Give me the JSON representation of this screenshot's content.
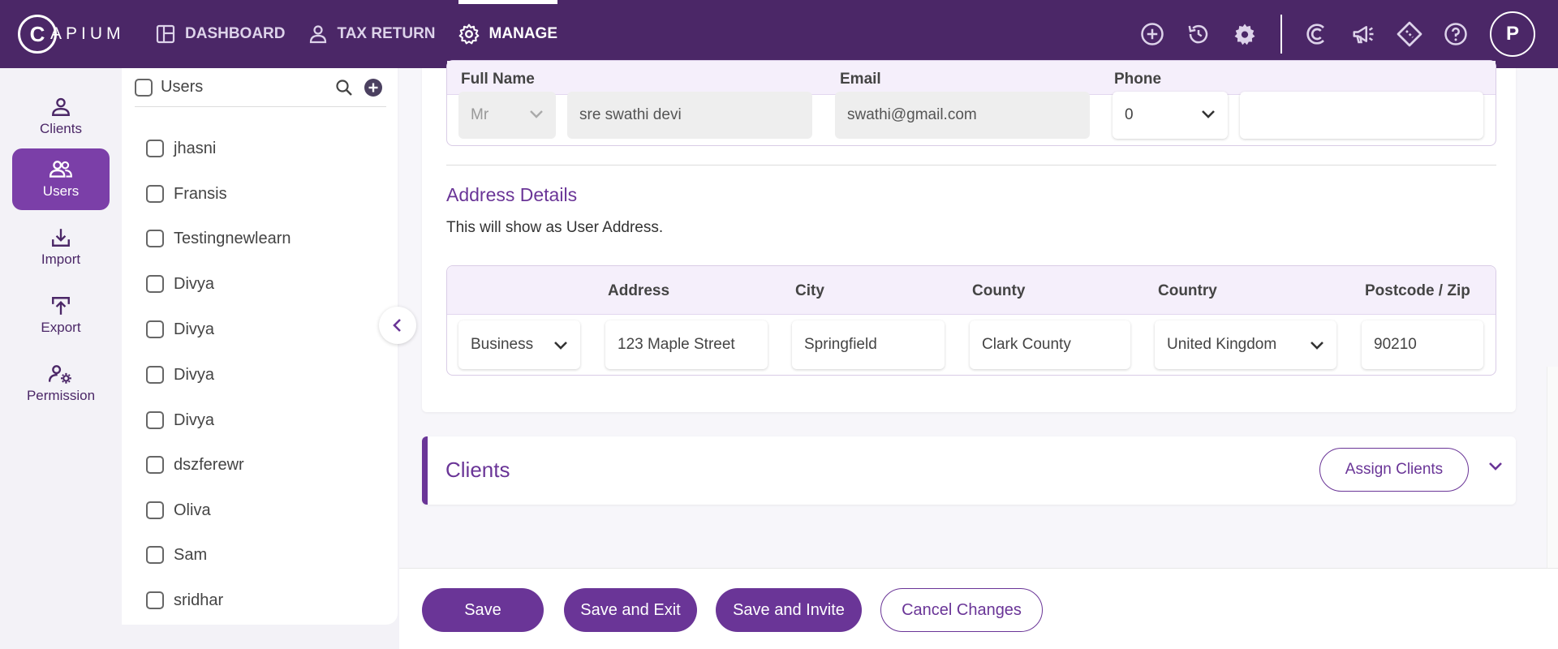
{
  "brand": {
    "logo_letter": "C",
    "logo_text": "APIUM"
  },
  "nav": [
    {
      "label": "DASHBOARD",
      "active": false
    },
    {
      "label": "TAX RETURN",
      "active": false
    },
    {
      "label": "MANAGE",
      "active": true
    }
  ],
  "top_icons": [
    "add-circle-icon",
    "history-icon",
    "settings-icon",
    "capium-icon",
    "megaphone-icon",
    "ticket-icon",
    "help-icon"
  ],
  "user_initial": "P",
  "rail": [
    {
      "label": "Clients",
      "icon": "person-icon",
      "active": false
    },
    {
      "label": "Users",
      "icon": "users-icon",
      "active": true
    },
    {
      "label": "Import",
      "icon": "import-icon",
      "active": false
    },
    {
      "label": "Export",
      "icon": "export-icon",
      "active": false
    },
    {
      "label": "Permission",
      "icon": "permission-icon",
      "active": false
    }
  ],
  "user_panel": {
    "title": "Users",
    "users": [
      "jhasni",
      "Fransis",
      "Testingnewlearn",
      "Divya",
      "Divya",
      "Divya",
      "Divya",
      "dszferewr",
      "Oliva",
      "Sam",
      "sridhar"
    ]
  },
  "contact": {
    "headers": {
      "full_name": "Full Name",
      "email": "Email",
      "phone": "Phone"
    },
    "title_value": "Mr",
    "name_value": "sre swathi devi",
    "email_value": "swathi@gmail.com",
    "phone_code": "0",
    "phone_value": ""
  },
  "address": {
    "section_title": "Address Details",
    "section_sub": "This will show as User Address.",
    "headers": {
      "address": "Address",
      "city": "City",
      "county": "County",
      "country": "Country",
      "postcode": "Postcode / Zip"
    },
    "type": "Business",
    "address": "123 Maple Street",
    "city": "Springfield",
    "county": "Clark County",
    "country": "United Kingdom",
    "postcode": "90210"
  },
  "clients_section": {
    "title": "Clients",
    "assign_label": "Assign Clients"
  },
  "footer": {
    "save": "Save",
    "save_exit": "Save and Exit",
    "save_invite": "Save and Invite",
    "cancel": "Cancel Changes"
  },
  "colors": {
    "topbar": "#4b2767",
    "accent": "#6a3597",
    "rail_active": "#7b3fa8"
  }
}
